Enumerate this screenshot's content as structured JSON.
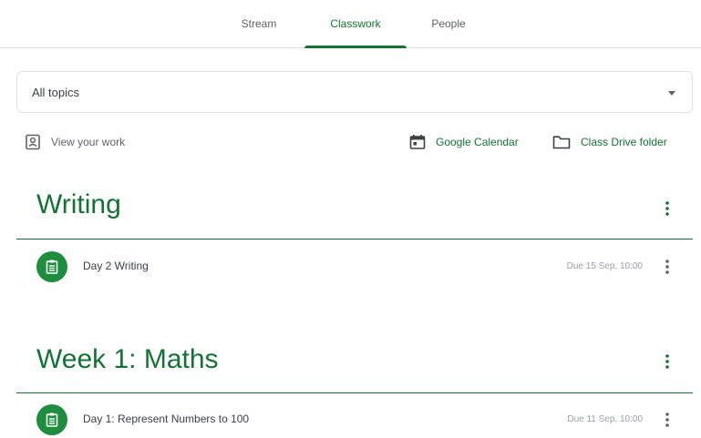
{
  "tabs": [
    {
      "label": "Stream"
    },
    {
      "label": "Classwork"
    },
    {
      "label": "People"
    }
  ],
  "active_tab": "Classwork",
  "topic_filter": {
    "selected": "All topics"
  },
  "links": {
    "view_work": "View your work",
    "calendar": "Google Calendar",
    "drive": "Class Drive folder"
  },
  "sections": [
    {
      "title": "Writing",
      "items": [
        {
          "title": "Day 2 Writing",
          "due": "Due 15 Sep, 10:00"
        }
      ]
    },
    {
      "title": "Week 1: Maths",
      "items": [
        {
          "title": "Day 1: Represent Numbers to 100",
          "due": "Due 11 Sep, 10:00"
        }
      ]
    }
  ],
  "colors": {
    "accent": "#137333",
    "icon_bg": "#1e8e3e",
    "divider": "#e0e0e0"
  },
  "icons": [
    "assignment-icon",
    "calendar-icon",
    "folder-icon",
    "more-vert-icon",
    "dropdown-caret-icon",
    "person-badge-icon"
  ]
}
